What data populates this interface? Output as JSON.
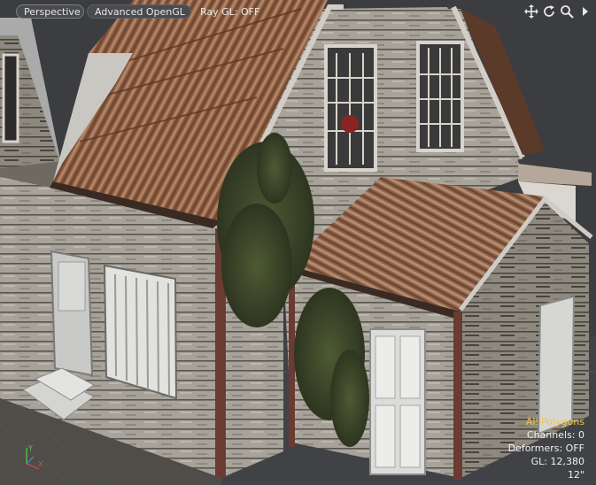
{
  "viewport": {
    "view_mode": "Perspective",
    "render_mode": "Advanced OpenGL",
    "ray_gl": "Ray GL: OFF"
  },
  "nav_icons": [
    "move-view-icon",
    "rotate-view-icon",
    "zoom-view-icon",
    "expand-arrow-icon"
  ],
  "stats": {
    "selection": "All Polygons",
    "channels": "Channels: 0",
    "deformers": "Deformers: OFF",
    "gl": "GL: 12,380",
    "grid_size": "12\""
  },
  "colors": {
    "viewport_bg": "#3b3c3f",
    "selection_highlight": "#f4c44a",
    "stats_text": "#f0f0f0"
  }
}
